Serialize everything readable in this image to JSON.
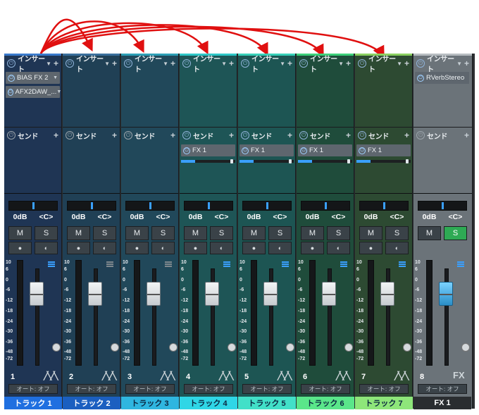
{
  "colors": {
    "arrow": "#e01010",
    "channels_bg": [
      "#1f3554",
      "#204055",
      "#21485a",
      "#1e5556",
      "#1d5553",
      "#1f4c3b",
      "#2d4a32",
      "#6b7379"
    ],
    "channels_top": [
      "#3a7acc",
      "#3a6f9c",
      "#2d9fb6",
      "#2fc7c7",
      "#38d0b8",
      "#3dd07a",
      "#8ad060",
      "#b7bdc1"
    ],
    "name_bg": [
      "#1f6fe0",
      "#1b5fc0",
      "#2fb6e0",
      "#2fd6e6",
      "#42e0c8",
      "#5ae68a",
      "#8ee67a",
      "#2a2d30"
    ],
    "name_fg": [
      "#ffffff",
      "#ffffff",
      "#0b2640",
      "#0b2640",
      "#0b2640",
      "#0b2640",
      "#0b2640",
      "#ffffff"
    ]
  },
  "insert_label": "インサート",
  "send_label": "センド",
  "channels": [
    {
      "inserts": [
        "BIAS FX 2",
        "AFX2DAW_..."
      ],
      "send": null,
      "pan_db": "0dB",
      "pan": "<C>",
      "mute": "M",
      "solo": "S",
      "number": "1",
      "auto": "オート: オフ",
      "name": "トラック 1"
    },
    {
      "inserts": [],
      "send": null,
      "pan_db": "0dB",
      "pan": "<C>",
      "mute": "M",
      "solo": "S",
      "number": "2",
      "auto": "オート: オフ",
      "name": "トラック 2"
    },
    {
      "inserts": [],
      "send": null,
      "pan_db": "0dB",
      "pan": "<C>",
      "mute": "M",
      "solo": "S",
      "number": "3",
      "auto": "オート: オフ",
      "name": "トラック 3"
    },
    {
      "inserts": [],
      "send": "FX 1",
      "pan_db": "0dB",
      "pan": "<C>",
      "mute": "M",
      "solo": "S",
      "number": "4",
      "auto": "オート: オフ",
      "name": "トラック 4"
    },
    {
      "inserts": [],
      "send": "FX 1",
      "pan_db": "0dB",
      "pan": "<C>",
      "mute": "M",
      "solo": "S",
      "number": "5",
      "auto": "オート: オフ",
      "name": "トラック 5"
    },
    {
      "inserts": [],
      "send": "FX 1",
      "pan_db": "0dB",
      "pan": "<C>",
      "mute": "M",
      "solo": "S",
      "number": "6",
      "auto": "オート: オフ",
      "name": "トラック 6"
    },
    {
      "inserts": [],
      "send": "FX 1",
      "pan_db": "0dB",
      "pan": "<C>",
      "mute": "M",
      "solo": "S",
      "number": "7",
      "auto": "オート: オフ",
      "name": "トラック 7"
    },
    {
      "inserts": [
        "RVerbStereo"
      ],
      "send": null,
      "pan_db": "0dB",
      "pan": "<C>",
      "mute": "M",
      "solo": "S",
      "number": "8",
      "auto": "オート: オフ",
      "name": "FX 1",
      "fx_label": "FX",
      "solo_on": true
    }
  ],
  "scale_labels": [
    "10",
    "6",
    "0",
    "-6",
    "-12",
    "-18",
    "-24",
    "-30",
    "-36",
    "-48",
    "-72"
  ]
}
